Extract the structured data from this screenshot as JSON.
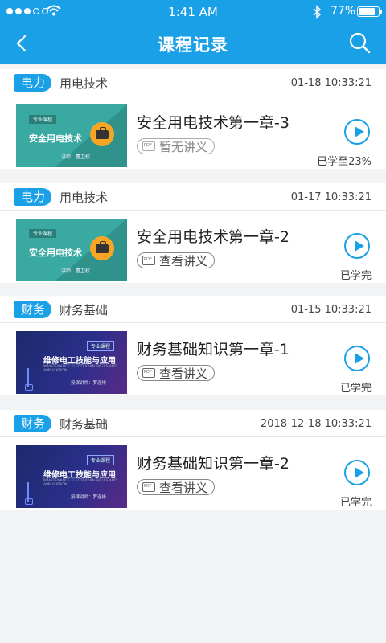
{
  "status_bar": {
    "time": "1:41 AM",
    "battery_text": "77%",
    "battery_level": 0.77,
    "signal_bars": 3
  },
  "header": {
    "title": "课程记录",
    "back_icon": "chevron-left-icon",
    "search_icon": "search-icon"
  },
  "colors": {
    "accent": "#1aa0e6",
    "background": "#f2f3f5"
  },
  "records": [
    {
      "tag": "电力",
      "subject": "用电技术",
      "date": "01-18 10:33:21",
      "thumb": {
        "style": "teal",
        "badge": "专业课程",
        "title": "安全用电技术",
        "lecturer": "讲师：曹卫权"
      },
      "lesson_title": "安全用电技术第一章-3",
      "handout": "暂无讲义",
      "handout_available": false,
      "progress": "已学至23%"
    },
    {
      "tag": "电力",
      "subject": "用电技术",
      "date": "01-17 10:33:21",
      "thumb": {
        "style": "teal",
        "badge": "专业课程",
        "title": "安全用电技术",
        "lecturer": "讲师：曹卫权"
      },
      "lesson_title": "安全用电技术第一章-2",
      "handout": "查看讲义",
      "handout_available": true,
      "progress": "已学完"
    },
    {
      "tag": "财务",
      "subject": "财务基础",
      "date": "01-15 10:33:21",
      "thumb": {
        "style": "purple",
        "badge": "专业课程",
        "title": "维修电工技能与应用",
        "subtitle": "MAINTENANCE ELECTRICIAN SKILLS AND APPLICATION",
        "lecturer": "授课讲师：罗连彬"
      },
      "lesson_title": "财务基础知识第一章-1",
      "handout": "查看讲义",
      "handout_available": true,
      "progress": "已学完"
    },
    {
      "tag": "财务",
      "subject": "财务基础",
      "date": "2018-12-18 10:33:21",
      "thumb": {
        "style": "purple",
        "badge": "专业课程",
        "title": "维修电工技能与应用",
        "subtitle": "MAINTENANCE ELECTRICIAN SKILLS AND APPLICATION",
        "lecturer": "授课讲师：罗连彬"
      },
      "lesson_title": "财务基础知识第一章-2",
      "handout": "查看讲义",
      "handout_available": true,
      "progress": "已学完"
    }
  ]
}
